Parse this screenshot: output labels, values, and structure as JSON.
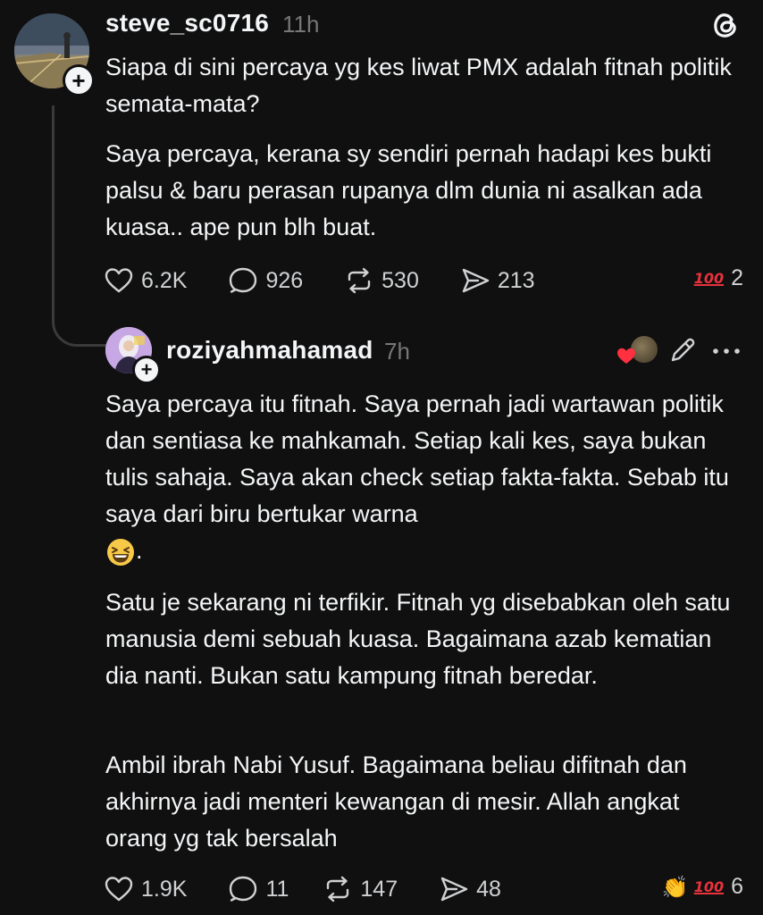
{
  "post1": {
    "username": "steve_sc0716",
    "time": "11h",
    "paragraphs": [
      "Siapa di sini percaya yg kes liwat PMX adalah fitnah politik semata-mata?",
      "Saya percaya, kerana sy sendiri pernah hadapi kes bukti palsu & baru perasan rupanya dlm dunia ni asalkan ada kuasa.. ape pun blh buat."
    ],
    "stats": {
      "likes": "6.2K",
      "replies": "926",
      "reposts": "530",
      "shares": "213"
    },
    "reaction_emoji": "100-emoji",
    "reaction_count": "2"
  },
  "post2": {
    "username": "roziyahmahamad",
    "time": "7h",
    "paragraph1": "Saya percaya itu fitnah. Saya pernah jadi wartawan politik dan sentiasa ke mahkamah. Setiap kali kes, saya bukan tulis sahaja. Saya akan check setiap fakta-fakta. Sebab itu saya dari biru bertukar warna",
    "paragraph1_end": ".",
    "paragraph2": "Satu je sekarang ni terfikir. Fitnah yg disebabkan oleh satu manusia demi sebuah kuasa. Bagaimana azab kematian dia nanti. Bukan satu kampung fitnah beredar.",
    "paragraph3": "Ambil ibrah Nabi Yusuf. Bagaimana beliau difitnah dan akhirnya jadi menteri kewangan di mesir. Allah angkat orang yg tak bersalah",
    "stats": {
      "likes": "1.9K",
      "replies": "11",
      "reposts": "147",
      "shares": "48"
    },
    "reaction_emojis": [
      "clapping-hands-emoji",
      "100-emoji"
    ],
    "reaction_count": "6"
  },
  "colors": {
    "background": "#101010",
    "text": "#f3f5f7",
    "muted": "#777777",
    "hundred_red": "#e8323c"
  }
}
